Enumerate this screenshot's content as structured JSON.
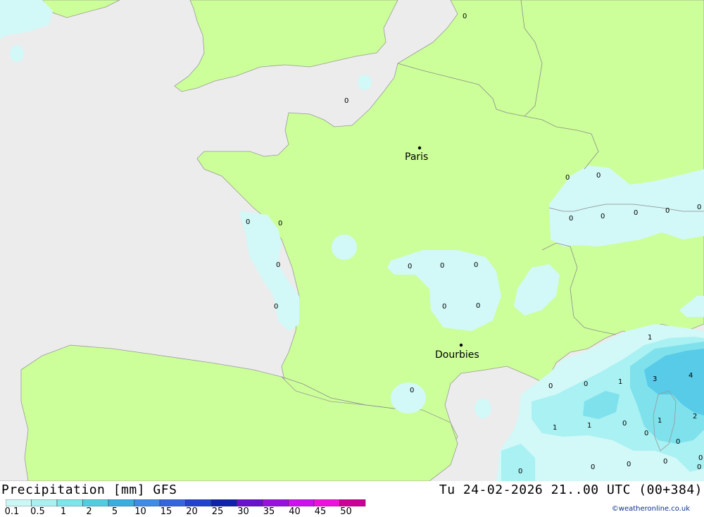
{
  "map": {
    "cities": [
      {
        "name": "Paris"
      },
      {
        "name": "Dourbies"
      }
    ],
    "values": [
      "0",
      "0",
      "0",
      "0",
      "0",
      "0",
      "0",
      "0",
      "0",
      "0",
      "0",
      "0",
      "0",
      "0",
      "0",
      "0",
      "0",
      "0",
      "0",
      "0",
      "0",
      "0",
      "1",
      "3",
      "4",
      "0",
      "0",
      "1",
      "1",
      "1",
      "0",
      "1",
      "2",
      "0",
      "0",
      "0",
      "0",
      "0"
    ]
  },
  "footer": {
    "title": "Precipitation [mm] GFS",
    "datetime": "Tu 24-02-2026 21..00 UTC (00+384)",
    "credit": "©weatheronline.co.uk"
  },
  "legend": {
    "ticks": [
      "0.1",
      "0.5",
      "1",
      "2",
      "5",
      "10",
      "15",
      "20",
      "25",
      "30",
      "35",
      "40",
      "45",
      "50"
    ],
    "colors": [
      "#ccf7f5",
      "#aaf0f0",
      "#7de6e8",
      "#52cde0",
      "#3aaee0",
      "#3b8ee6",
      "#3366dd",
      "#2244cc",
      "#1122aa",
      "#6a11cc",
      "#9911dd",
      "#cc11ee",
      "#ee11dd",
      "#cc0099"
    ]
  },
  "colors": {
    "land": "#ccff99",
    "sea": "#ececec",
    "precip_light": "#d2f8f8",
    "precip_mid": "#8eeef0",
    "precip_heavy": "#5dc8e6"
  }
}
